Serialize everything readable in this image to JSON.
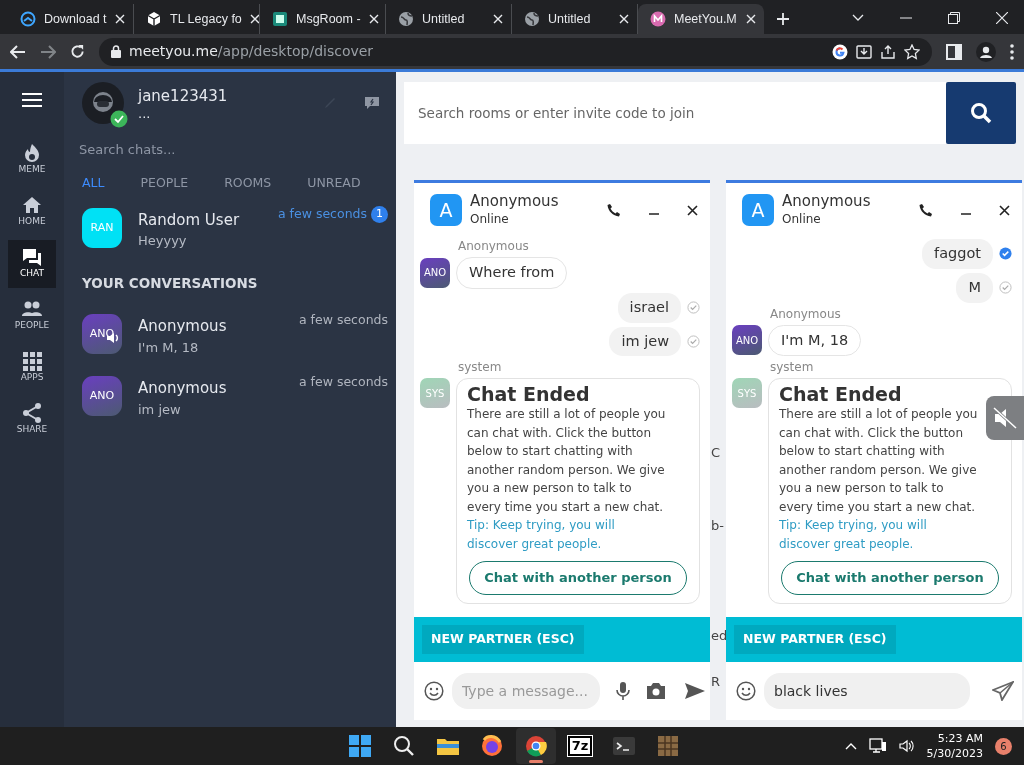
{
  "browser": {
    "tabs": [
      {
        "title": "Download t",
        "kind": "download",
        "selected": false
      },
      {
        "title": "TL Legacy fo",
        "kind": "cube",
        "selected": false
      },
      {
        "title": "MsgRoom -",
        "kind": "msgroom",
        "selected": false
      },
      {
        "title": "Untitled",
        "kind": "globe",
        "selected": false
      },
      {
        "title": "Untitled",
        "kind": "globe",
        "selected": false
      },
      {
        "title": "MeetYou.M",
        "kind": "meetyou",
        "selected": true
      }
    ],
    "url_host": "meetyou.me",
    "url_path": "/app/desktop/discover"
  },
  "rail": {
    "items": [
      {
        "label": "MEME",
        "kind": "meme",
        "selected": false
      },
      {
        "label": "HOME",
        "kind": "home",
        "selected": false
      },
      {
        "label": "CHAT",
        "kind": "chat",
        "selected": true
      },
      {
        "label": "PEOPLE",
        "kind": "people",
        "selected": false
      },
      {
        "label": "APPS",
        "kind": "apps",
        "selected": false
      },
      {
        "label": "SHARE",
        "kind": "share",
        "selected": false
      }
    ]
  },
  "profile": {
    "username": "jane123431",
    "status": "...",
    "verified": true
  },
  "chat_search": {
    "placeholder": "Search chats..."
  },
  "filters": [
    {
      "label": "ALL",
      "selected": true
    },
    {
      "label": "PEOPLE",
      "selected": false
    },
    {
      "label": "ROOMS",
      "selected": false
    },
    {
      "label": "UNREAD",
      "selected": false
    }
  ],
  "pinned": {
    "avatar": "RAN",
    "color": "#00e1f5",
    "name": "Random User",
    "preview": "Heyyyy",
    "time": "a few seconds",
    "unread": "1"
  },
  "section_title": "YOUR CONVERSATIONS",
  "conversations": [
    {
      "avatar": "ANO",
      "name": "Anonymous",
      "preview": "I'm M, 18",
      "time": "a few seconds",
      "speaking": true
    },
    {
      "avatar": "ANO",
      "name": "Anonymous",
      "preview": "im jew",
      "time": "a few seconds",
      "speaking": false
    }
  ],
  "room_search": {
    "placeholder": "Search rooms or enter invite code to join"
  },
  "chat_windows": [
    {
      "avatar_letter": "A",
      "name": "Anonymous",
      "status": "Online",
      "messages": [
        {
          "kind": "incoming",
          "sender": "Anonymous",
          "avatar": "ANO",
          "text": "Where from"
        },
        {
          "kind": "outgoing",
          "text": "israel",
          "read": false
        },
        {
          "kind": "outgoing",
          "text": "im jew",
          "read": false
        },
        {
          "kind": "system",
          "sender": "system",
          "avatar": "SYS",
          "title": "Chat Ended",
          "body": "There are still a lot of people you can chat with. Click the button below to start chatting with another random person. We give you a new person to talk to every time you start a new chat.",
          "tip": "Tip: Keep trying, you will discover great people.",
          "button": "Chat with another person"
        }
      ],
      "new_partner": "NEW PARTNER (ESC)",
      "composer": {
        "placeholder": "Type a message...",
        "media_buttons": true
      }
    },
    {
      "avatar_letter": "A",
      "name": "Anonymous",
      "status": "Online",
      "messages": [
        {
          "kind": "outgoing",
          "text": "faggot",
          "read": true
        },
        {
          "kind": "outgoing",
          "text": "M",
          "read": false
        },
        {
          "kind": "incoming",
          "sender": "Anonymous",
          "avatar": "ANO",
          "text": "I'm M, 18"
        },
        {
          "kind": "system",
          "sender": "system",
          "avatar": "SYS",
          "title": "Chat Ended",
          "body": "There are still a lot of people you can chat with. Click the button below to start chatting with another random person. We give you a new person to talk to every time you start a new chat.",
          "tip": "Tip: Keep trying, you will discover great people.",
          "button": "Chat with another person"
        }
      ],
      "new_partner": "NEW PARTNER (ESC)",
      "composer": {
        "value": "black lives ",
        "media_buttons": false
      }
    }
  ],
  "background_fragments": [
    "C",
    "b-",
    "ed",
    "R"
  ],
  "taskbar": {
    "apps": [
      {
        "kind": "start",
        "selected": false
      },
      {
        "kind": "search",
        "selected": false
      },
      {
        "kind": "files",
        "selected": false
      },
      {
        "kind": "firefox",
        "selected": false
      },
      {
        "kind": "chrome",
        "selected": true
      },
      {
        "kind": "archiver",
        "label": "7z",
        "selected": false
      },
      {
        "kind": "terminal",
        "selected": false
      },
      {
        "kind": "crate",
        "selected": false
      }
    ],
    "time": "5:23 AM",
    "date": "5/30/2023",
    "notifications": "6"
  }
}
